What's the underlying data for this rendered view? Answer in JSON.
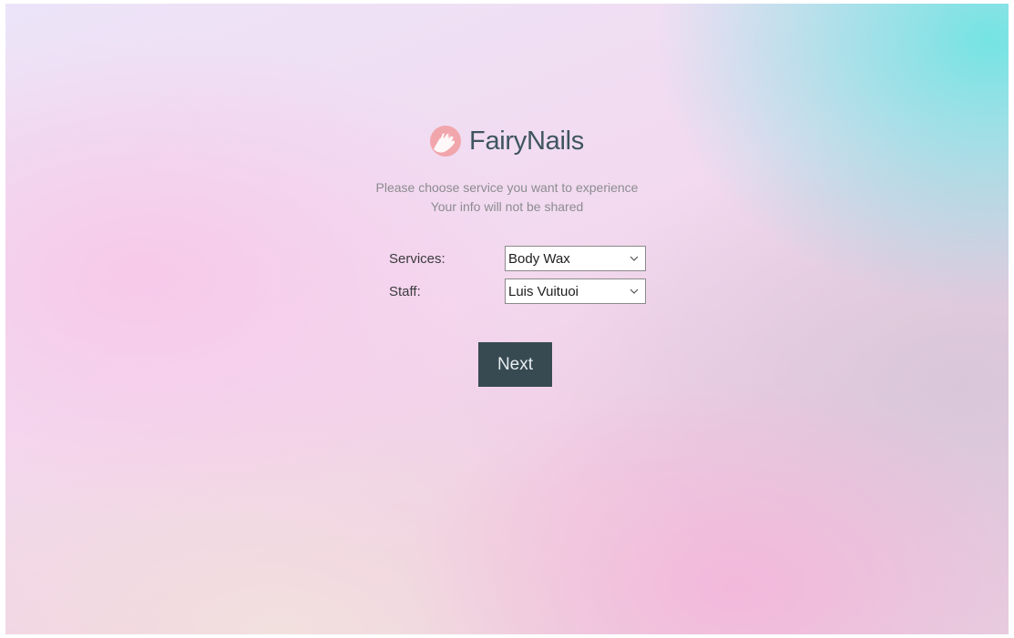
{
  "app": {
    "brand_name": "FairyNails",
    "logo_icon": "nail-polish-hand-icon"
  },
  "intro": {
    "line1": "Please choose service you want to experience",
    "line2": "Your info will not be shared"
  },
  "form": {
    "services": {
      "label": "Services:",
      "selected": "Body Wax"
    },
    "staff": {
      "label": "Staff:",
      "selected": "Luis Vuituoi"
    }
  },
  "actions": {
    "next_label": "Next"
  },
  "colors": {
    "button_bg": "#374a52",
    "brand_text": "#3f5560",
    "logo_bg": "#f1a6ac"
  }
}
